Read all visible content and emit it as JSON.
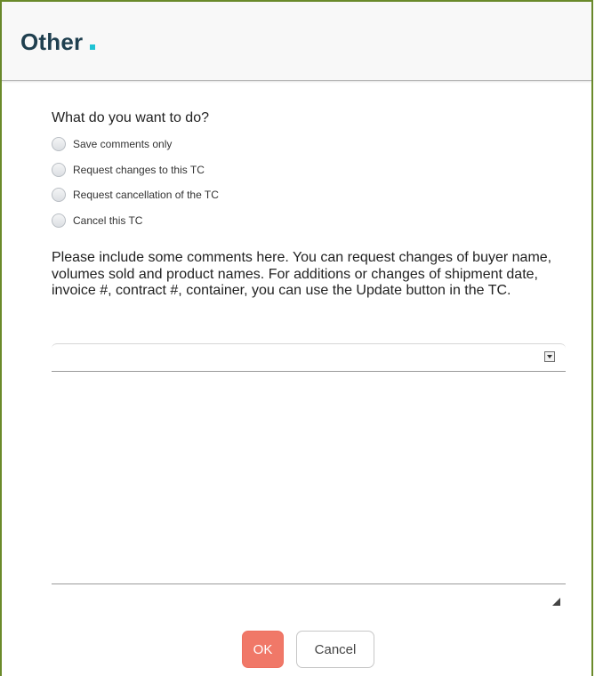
{
  "dialog": {
    "title": "Other",
    "accent_color": "#1fc3d4"
  },
  "form": {
    "question": "What do you want to do?",
    "options": [
      {
        "label": "Save comments only",
        "selected": false
      },
      {
        "label": "Request changes to this TC",
        "selected": false
      },
      {
        "label": "Request cancellation of the TC",
        "selected": false
      },
      {
        "label": "Cancel this TC",
        "selected": false
      }
    ],
    "instructions": "Please include some comments here. You can request changes of buyer name, volumes sold and product names. For additions or changes of shipment date, invoice #, contract #, container, you can use the Update button in the TC.",
    "comment_value": ""
  },
  "buttons": {
    "ok_label": "OK",
    "ok_color": "#f07868",
    "cancel_label": "Cancel"
  }
}
